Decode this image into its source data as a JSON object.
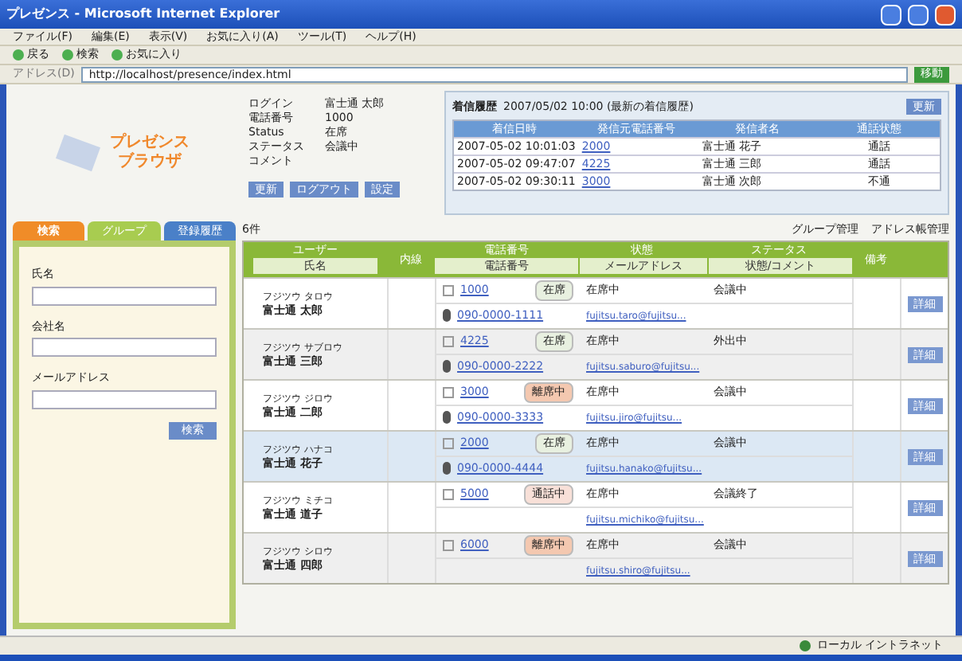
{
  "window": {
    "title": "プレゼンス - Microsoft Internet Explorer"
  },
  "menu": [
    "ファイル(F)",
    "編集(E)",
    "表示(V)",
    "お気に入り(A)",
    "ツール(T)",
    "ヘルプ(H)"
  ],
  "toolbar": [
    "戻る",
    "検索",
    "お気に入り"
  ],
  "address": {
    "label": "アドレス(D)",
    "value": "http://localhost/presence/index.html",
    "go": "移動"
  },
  "logo": {
    "line1": "プレゼンス",
    "line2": "ブラウザ"
  },
  "user": {
    "fields": [
      {
        "label": "ログイン",
        "value": "富士通 太郎"
      },
      {
        "label": "電話番号",
        "value": "1000"
      },
      {
        "label": "Status",
        "value": "在席"
      },
      {
        "label": "ステータス",
        "value": "会議中"
      },
      {
        "label": "コメント"
      }
    ],
    "buttons": [
      "更新",
      "ログアウト",
      "設定"
    ]
  },
  "history": {
    "title": "着信履歴",
    "subtitle": "2007/05/02 10:00 (最新の着信履歴)",
    "button": "更新",
    "columns": [
      "着信日時",
      "発信元電話番号",
      "発信者名",
      "通話状態"
    ],
    "rows": [
      [
        "2007-05-02 10:01:03",
        "2000",
        "富士通 花子",
        "通話"
      ],
      [
        "2007-05-02 09:47:07",
        "4225",
        "富士通 三郎",
        "通話"
      ],
      [
        "2007-05-02 09:30:11",
        "3000",
        "富士通 次郎",
        "不通"
      ]
    ]
  },
  "tabs": [
    {
      "label": "検索",
      "selected": true
    },
    {
      "label": "グループ",
      "selected": false
    },
    {
      "label": "登録履歴",
      "selected": false
    }
  ],
  "search": {
    "fields": [
      {
        "label": "氏名"
      },
      {
        "label": "会社名"
      },
      {
        "label": "メールアドレス"
      }
    ],
    "button": "検索"
  },
  "list": {
    "count": "6件",
    "links": [
      "グループ管理",
      "アドレス帳管理"
    ],
    "header1": [
      "ユーザー",
      "内線",
      "電話番号",
      "状態",
      "ステータス",
      "備考"
    ],
    "header2": [
      "氏名",
      "電話番号",
      "メールアドレス",
      "状態/コメント"
    ],
    "rows": [
      {
        "kana": "フジツウ タロウ",
        "name": "富士通 太郎",
        "phone": "1000",
        "badge": "在席",
        "color": "#e8f0e0",
        "status": "在席中",
        "status2": "会議中",
        "mobile": "090-0000-1111",
        "email": "fujitsu.taro@fujitsu...",
        "button": "詳細",
        "selected": false
      },
      {
        "kana": "フジツウ サブロウ",
        "name": "富士通 三郎",
        "phone": "4225",
        "badge": "在席",
        "color": "#e8f0e0",
        "status": "在席中",
        "status2": "外出中",
        "mobile": "090-0000-2222",
        "email": "fujitsu.saburo@fujitsu...",
        "button": "詳細",
        "selected": false
      },
      {
        "kana": "フジツウ ジロウ",
        "name": "富士通 二郎",
        "phone": "3000",
        "badge": "離席中",
        "color": "#f4c8b0",
        "status": "在席中",
        "status2": "会議中",
        "mobile": "090-0000-3333",
        "email": "fujitsu.jiro@fujitsu...",
        "button": "詳細",
        "selected": false
      },
      {
        "kana": "フジツウ ハナコ",
        "name": "富士通 花子",
        "phone": "2000",
        "badge": "在席",
        "color": "#e8f0e0",
        "status": "在席中",
        "status2": "会議中",
        "mobile": "090-0000-4444",
        "email": "fujitsu.hanako@fujitsu...",
        "button": "詳細",
        "selected": true
      },
      {
        "kana": "フジツウ ミチコ",
        "name": "富士通 道子",
        "phone": "5000",
        "badge": "通話中",
        "color": "#f8e0d8",
        "status": "在席中",
        "status2": "会議終了",
        "email": "fujitsu.michiko@fujitsu...",
        "button": "詳細",
        "selected": false
      },
      {
        "kana": "フジツウ シロウ",
        "name": "富士通 四郎",
        "phone": "6000",
        "badge": "離席中",
        "color": "#f4c8b0",
        "status": "在席中",
        "status2": "会議中",
        "email": "fujitsu.shiro@fujitsu...",
        "button": "詳細",
        "selected": false
      }
    ]
  },
  "status_bar": {
    "zone": "ローカル イントラネット"
  }
}
